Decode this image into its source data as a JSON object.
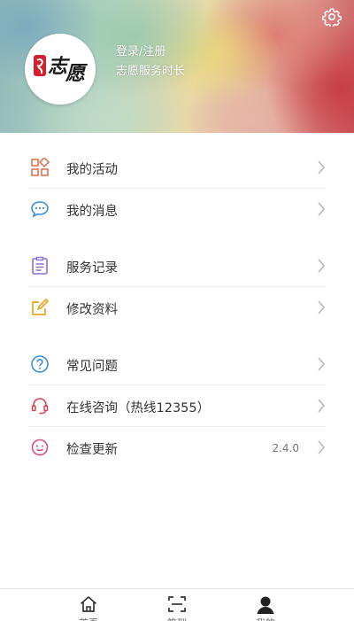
{
  "header": {
    "login_text": "登录/注册",
    "service_hours_text": "志愿服务时长",
    "logo_text": "志愿"
  },
  "menu": {
    "groups": [
      {
        "items": [
          {
            "label": "我的活动",
            "icon": "grid-icon",
            "icon_color": "#e0734f"
          },
          {
            "label": "我的消息",
            "icon": "chat-bubble-icon",
            "icon_color": "#3a8ed8"
          }
        ]
      },
      {
        "items": [
          {
            "label": "服务记录",
            "icon": "clipboard-icon",
            "icon_color": "#8a6fcf"
          },
          {
            "label": "修改资料",
            "icon": "edit-icon",
            "icon_color": "#e7a521"
          }
        ]
      },
      {
        "items": [
          {
            "label": "常见问题",
            "icon": "question-icon",
            "icon_color": "#3a8ed8"
          },
          {
            "label": "在线咨询（热线12355）",
            "icon": "headset-icon",
            "icon_color": "#d9424e"
          },
          {
            "label": "检查更新",
            "icon": "update-smile-icon",
            "icon_color": "#d84f8a",
            "value": "2.4.0"
          }
        ]
      }
    ]
  },
  "tabbar": {
    "tabs": [
      {
        "label": "首页",
        "icon": "home-icon"
      },
      {
        "label": "签到",
        "icon": "scan-icon"
      },
      {
        "label": "我的",
        "icon": "person-icon",
        "active": true
      }
    ]
  },
  "colors": {
    "chevron": "#b8b8b8",
    "tab_icon": "#333333",
    "tab_active": "#222222"
  }
}
